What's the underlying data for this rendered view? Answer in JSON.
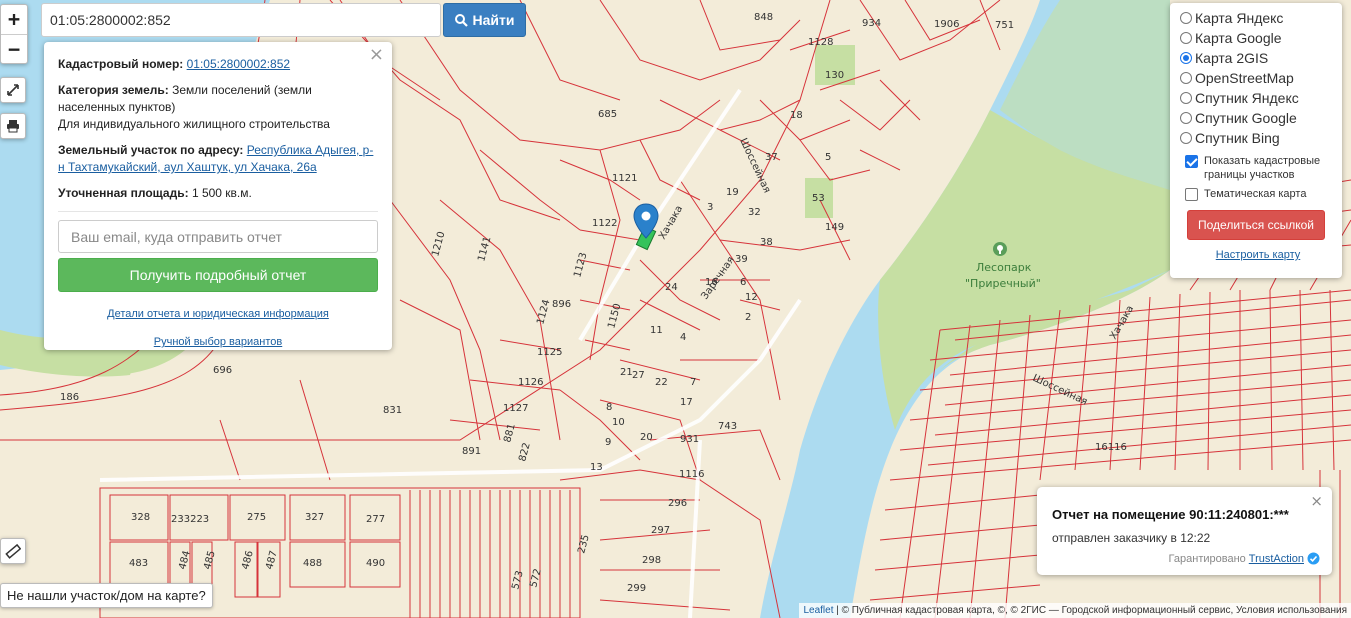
{
  "search": {
    "value": "01:05:2800002:852",
    "button_label": "Найти"
  },
  "zoom": {
    "in_label": "+",
    "out_label": "−"
  },
  "info": {
    "cadastral_label": "Кадастровый номер:",
    "cadastral_value": "01:05:2800002:852",
    "category_label": "Категория земель:",
    "category_value": "Земли поселений (земли населенных пунктов)",
    "category_use": "Для индивидуального жилищного строительства",
    "address_label": "Земельный участок по адресу:",
    "address_value": "Республика Адыгея, р-н Тахтамукайский, аул Хаштук, ул Хачака, 26а",
    "area_label": "Уточненная площадь:",
    "area_value": "1 500 кв.м.",
    "email_placeholder": "Ваш email, куда отправить отчет",
    "report_button": "Получить подробный отчет",
    "details_link": "Детали отчета и юридическая информация",
    "manual_link": "Ручной выбор вариантов",
    "close": "×"
  },
  "layers": {
    "options": [
      {
        "label": "Карта Яндекс",
        "selected": false
      },
      {
        "label": "Карта Google",
        "selected": false
      },
      {
        "label": "Карта 2GIS",
        "selected": true
      },
      {
        "label": "OpenStreetMap",
        "selected": false
      },
      {
        "label": "Спутник Яндекс",
        "selected": false
      },
      {
        "label": "Спутник Google",
        "selected": false
      },
      {
        "label": "Спутник Bing",
        "selected": false
      }
    ],
    "show_borders_label": "Показать кадастровые границы участков",
    "show_borders": true,
    "thematic_label": "Тематическая карта",
    "thematic": false,
    "share_button": "Поделиться ссылкой",
    "settings_link": "Настроить карту"
  },
  "notice": {
    "title": "Отчет на помещение 90:11:240801:***",
    "text": "отправлен заказчику в 12:22",
    "guarantee": "Гарантировано",
    "brand": "TrustAction",
    "close": "×"
  },
  "not_found_label": "Не нашли участок/дом на карте?",
  "attribution": {
    "leaflet": "Leaflet",
    "rest": " | © Публичная кадастровая карта, ©, © 2ГИС — Городской информационный сервис, Условия использования"
  },
  "map": {
    "labels": [
      "848",
      "934",
      "1906",
      "751",
      "1128",
      "130",
      "685",
      "1121",
      "1122",
      "1210",
      "1141",
      "1123",
      "896",
      "1124",
      "1150",
      "1125",
      "696",
      "1126",
      "186",
      "831",
      "1127",
      "881",
      "891",
      "822",
      "743",
      "931",
      "1116",
      "296",
      "297",
      "298",
      "299",
      "328",
      "233223",
      "275",
      "327",
      "277",
      "483",
      "484",
      "485",
      "486",
      "487",
      "488",
      "490",
      "573",
      "572",
      "235",
      "37",
      "53",
      "149",
      "5",
      "21",
      "18",
      "12",
      "11",
      "2",
      "9",
      "13",
      "8",
      "4",
      "22",
      "27",
      "17",
      "7",
      "10",
      "3",
      "20",
      "19",
      "32",
      "38",
      "16",
      "39",
      "24",
      "6",
      "23"
    ],
    "street_labels": [
      "Хачака",
      "Шоссейная",
      "Хачака",
      "Заречная",
      "Шоссейная"
    ],
    "park_label": "Лесопарк",
    "park_name": "\"Приречный\"",
    "other_labels": [
      "16116"
    ]
  }
}
